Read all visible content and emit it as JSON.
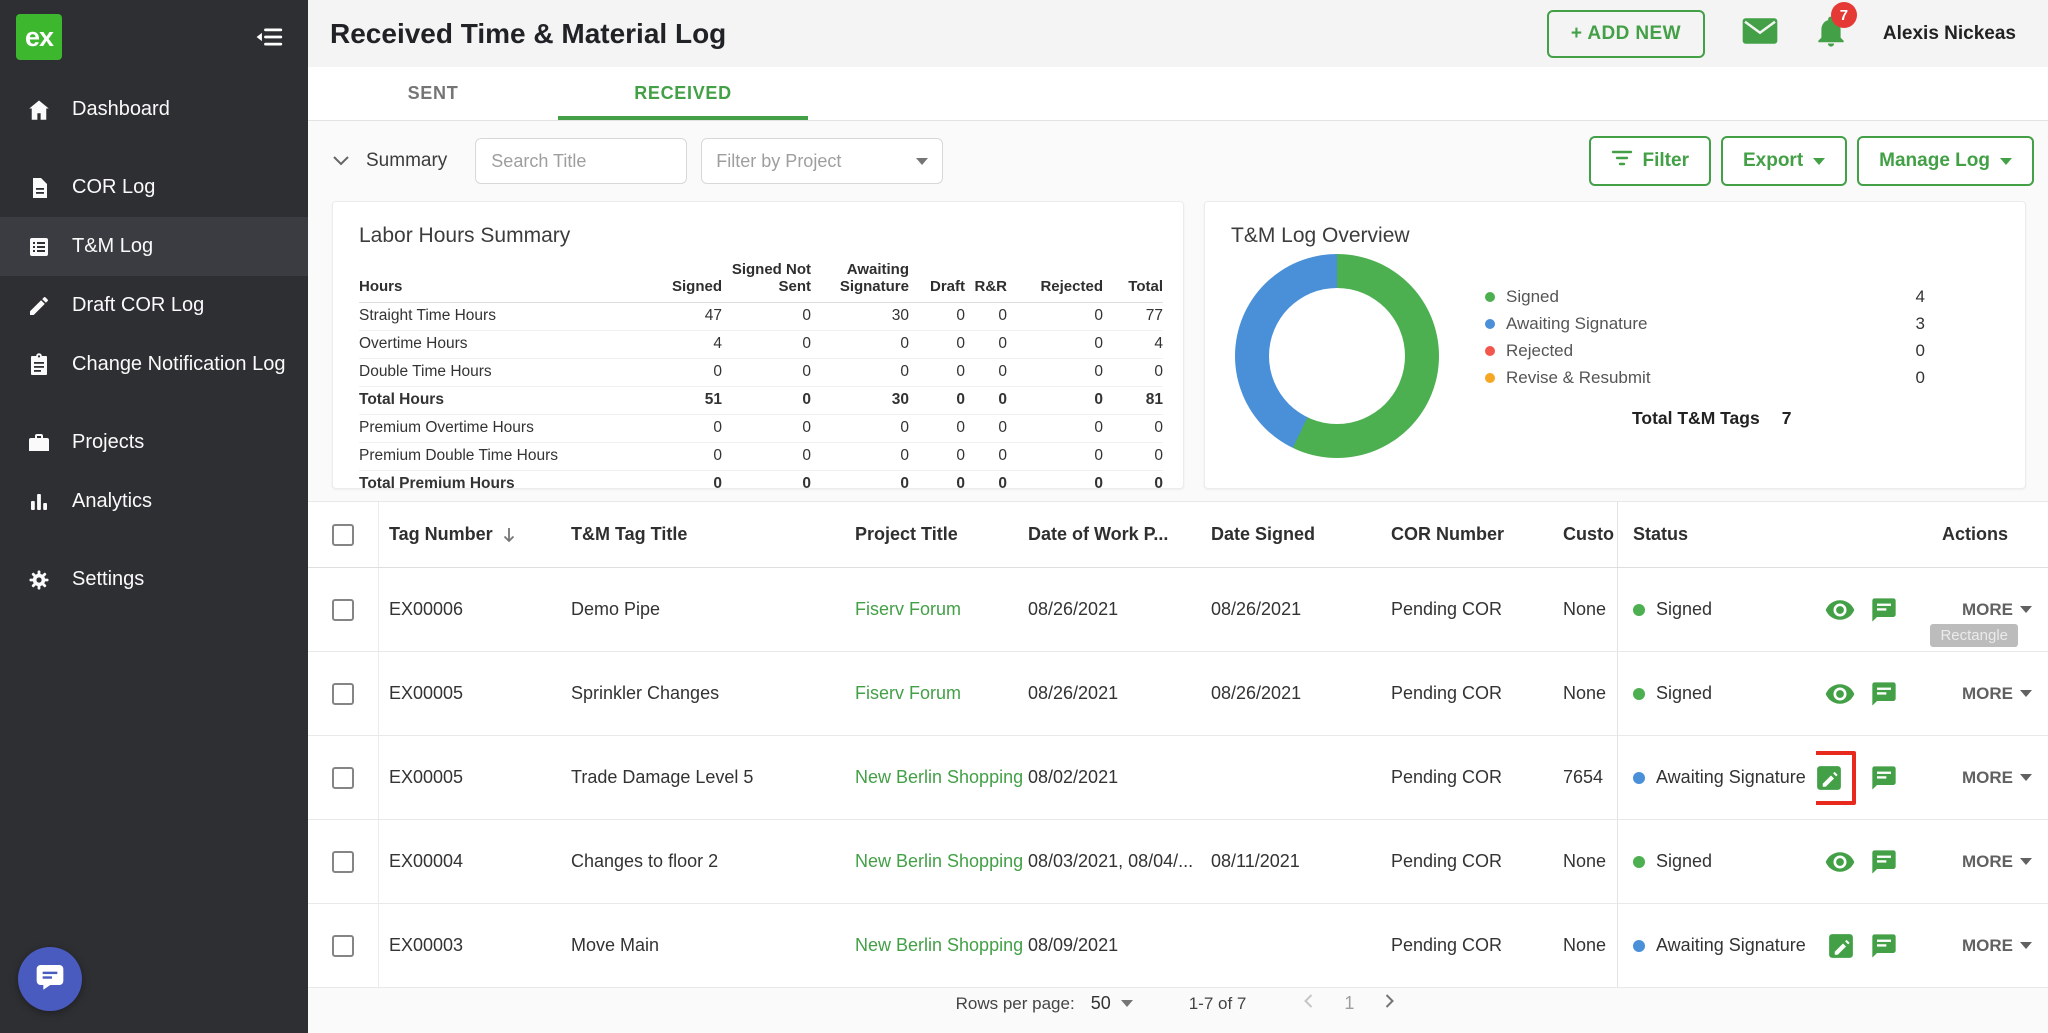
{
  "app": {
    "logo_text": "ex"
  },
  "sidebar": {
    "items": [
      {
        "label": "Dashboard"
      },
      {
        "label": "COR Log"
      },
      {
        "label": "T&M Log"
      },
      {
        "label": "Draft COR Log"
      },
      {
        "label": "Change Notification Log"
      },
      {
        "label": "Projects"
      },
      {
        "label": "Analytics"
      },
      {
        "label": "Settings"
      }
    ]
  },
  "header": {
    "title": "Received Time & Material Log",
    "add_new_label": "+ ADD NEW",
    "notification_count": "7",
    "user_name": "Alexis Nickeas"
  },
  "tabs": {
    "sent": "SENT",
    "received": "RECEIVED"
  },
  "toolbar": {
    "summary_label": "Summary",
    "search_placeholder": "Search Title",
    "project_filter_label": "Filter by Project",
    "filter_label": "Filter",
    "export_label": "Export",
    "manage_log_label": "Manage Log"
  },
  "labor_summary": {
    "title": "Labor Hours Summary",
    "columns": [
      "Hours",
      "Signed",
      "Signed Not Sent",
      "Awaiting Signature",
      "Draft",
      "R&R",
      "Rejected",
      "Total"
    ],
    "rows": [
      {
        "label": "Straight Time Hours",
        "values": [
          "47",
          "0",
          "30",
          "0",
          "0",
          "0",
          "77"
        ]
      },
      {
        "label": "Overtime Hours",
        "values": [
          "4",
          "0",
          "0",
          "0",
          "0",
          "0",
          "4"
        ]
      },
      {
        "label": "Double Time Hours",
        "values": [
          "0",
          "0",
          "0",
          "0",
          "0",
          "0",
          "0"
        ]
      },
      {
        "label": "Total Hours",
        "values": [
          "51",
          "0",
          "30",
          "0",
          "0",
          "0",
          "81"
        ]
      },
      {
        "label": "Premium Overtime Hours",
        "values": [
          "0",
          "0",
          "0",
          "0",
          "0",
          "0",
          "0"
        ]
      },
      {
        "label": "Premium Double Time Hours",
        "values": [
          "0",
          "0",
          "0",
          "0",
          "0",
          "0",
          "0"
        ]
      },
      {
        "label": "Total Premium Hours",
        "values": [
          "0",
          "0",
          "0",
          "0",
          "0",
          "0",
          "0"
        ]
      }
    ]
  },
  "overview": {
    "title": "T&M Log Overview",
    "legend": [
      {
        "label": "Signed",
        "value": "4",
        "color": "#4caf50"
      },
      {
        "label": "Awaiting Signature",
        "value": "3",
        "color": "#4a90d9"
      },
      {
        "label": "Rejected",
        "value": "0",
        "color": "#f2564d"
      },
      {
        "label": "Revise & Resubmit",
        "value": "0",
        "color": "#f5a623"
      }
    ],
    "total_label": "Total T&M Tags",
    "total_value": "7"
  },
  "chart_data": {
    "type": "pie",
    "title": "T&M Log Overview",
    "categories": [
      "Signed",
      "Awaiting Signature",
      "Rejected",
      "Revise & Resubmit"
    ],
    "values": [
      4,
      3,
      0,
      0
    ],
    "colors": [
      "#4caf50",
      "#4a90d9",
      "#f2564d",
      "#f5a623"
    ],
    "total_label": "Total T&M Tags",
    "total": 7,
    "legend_position": "right"
  },
  "table": {
    "more_label": "MORE",
    "columns": {
      "tag": "Tag Number",
      "title": "T&M Tag Title",
      "project": "Project Title",
      "date_of_work": "Date of Work P...",
      "date_signed": "Date Signed",
      "cor": "COR Number",
      "customer": "Custo",
      "status": "Status",
      "actions": "Actions"
    },
    "rows": [
      {
        "tag": "EX00006",
        "title": "Demo Pipe",
        "project": "Fiserv Forum",
        "date_of_work": "08/26/2021",
        "date_signed": "08/26/2021",
        "cor": "Pending COR",
        "customer": "None",
        "status": "Signed"
      },
      {
        "tag": "EX00005",
        "title": "Sprinkler Changes",
        "project": "Fiserv Forum",
        "date_of_work": "08/26/2021",
        "date_signed": "08/26/2021",
        "cor": "Pending COR",
        "customer": "None",
        "status": "Signed"
      },
      {
        "tag": "EX00005",
        "title": "Trade Damage Level 5",
        "project": "New Berlin Shopping (",
        "date_of_work": "08/02/2021",
        "date_signed": "",
        "cor": "Pending COR",
        "customer": "7654",
        "status": "Awaiting Signature"
      },
      {
        "tag": "EX00004",
        "title": "Changes to floor 2",
        "project": "New Berlin Shopping (",
        "date_of_work": "08/03/2021, 08/04/...",
        "date_signed": "08/11/2021",
        "cor": "Pending COR",
        "customer": "None",
        "status": "Signed"
      },
      {
        "tag": "EX00003",
        "title": "Move Main",
        "project": "New Berlin Shopping (",
        "date_of_work": "08/09/2021",
        "date_signed": "",
        "cor": "Pending COR",
        "customer": "None",
        "status": "Awaiting Signature"
      }
    ],
    "status_colors": {
      "Signed": "#4caf50",
      "Awaiting Signature": "#4a90d9"
    }
  },
  "pagination": {
    "rows_per_page_label": "Rows per page:",
    "rows_per_page_value": "50",
    "range_label": "1-7 of 7",
    "current_page": "1"
  },
  "artifacts": {
    "rectangle_label": "Rectangle"
  }
}
